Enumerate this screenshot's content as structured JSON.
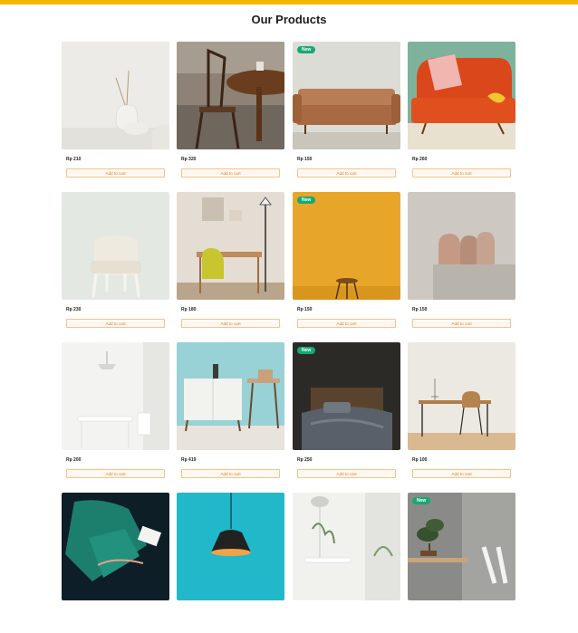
{
  "header": {
    "title": "Our Products",
    "accent_color": "#f5b800"
  },
  "products": [
    {
      "price": "Rp 210",
      "cart_label": "Add to cart",
      "badge": ""
    },
    {
      "price": "Rp 320",
      "cart_label": "Add to cart",
      "badge": ""
    },
    {
      "price": "Rp 150",
      "cart_label": "Add to cart",
      "badge": "New"
    },
    {
      "price": "Rp 260",
      "cart_label": "Add to cart",
      "badge": ""
    },
    {
      "price": "Rp 230",
      "cart_label": "Add to cart",
      "badge": ""
    },
    {
      "price": "Rp 180",
      "cart_label": "Add to cart",
      "badge": ""
    },
    {
      "price": "Rp 150",
      "cart_label": "Add to cart",
      "badge": "New"
    },
    {
      "price": "Rp 150",
      "cart_label": "Add to cart",
      "badge": ""
    },
    {
      "price": "Rp 200",
      "cart_label": "Add to cart",
      "badge": ""
    },
    {
      "price": "Rp 419",
      "cart_label": "Add to cart",
      "badge": ""
    },
    {
      "price": "Rp 250",
      "cart_label": "Add to cart",
      "badge": "New"
    },
    {
      "price": "Rp 100",
      "cart_label": "Add to cart",
      "badge": ""
    },
    {
      "price": "",
      "cart_label": "",
      "badge": ""
    },
    {
      "price": "",
      "cart_label": "",
      "badge": ""
    },
    {
      "price": "",
      "cart_label": "",
      "badge": ""
    },
    {
      "price": "",
      "cart_label": "",
      "badge": "New"
    }
  ],
  "colors": {
    "badge": "#16a974",
    "cart_border": "#f5c38a",
    "cart_text": "#e07a2a"
  }
}
